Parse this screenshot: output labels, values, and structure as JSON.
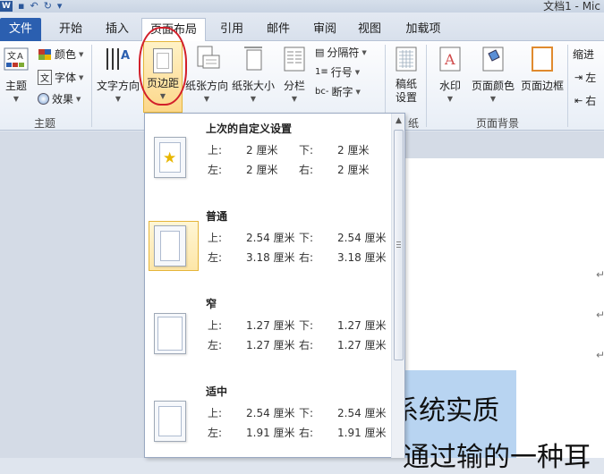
{
  "window": {
    "title": "文档1 - Mic"
  },
  "tabs": [
    {
      "label": "文件"
    },
    {
      "label": "开始"
    },
    {
      "label": "插入"
    },
    {
      "label": "页面布局",
      "active": true
    },
    {
      "label": "引用"
    },
    {
      "label": "邮件"
    },
    {
      "label": "审阅"
    },
    {
      "label": "视图"
    },
    {
      "label": "加载项"
    }
  ],
  "ribbon": {
    "themes_group": {
      "themes_label": "主题",
      "colors_label": "颜色",
      "fonts_label": "字体",
      "effects_label": "效果",
      "group_label": "主题"
    },
    "page_setup_group": {
      "text_direction_label": "文字方向",
      "margins_label": "页边距",
      "orientation_label": "纸张方向",
      "size_label": "纸张大小",
      "columns_label": "分栏",
      "breaks_label": "分隔符",
      "line_numbers_label": "行号",
      "hyphenation_label": "断字"
    },
    "manuscript_group": {
      "settings_label": "稿纸\n设置",
      "group_label_partial": "纸"
    },
    "page_background_group": {
      "watermark_label": "水印",
      "page_color_label": "页面颜色",
      "page_borders_label": "页面边框",
      "group_label": "页面背景"
    },
    "paragraph_partial": {
      "indent_label": "缩进",
      "left_label": "左",
      "right_label": "右"
    }
  },
  "margins_menu": {
    "items": [
      {
        "heading": "上次的自定义设置",
        "top_label": "上:",
        "top": "2 厘米",
        "bottom_label": "下:",
        "bottom": "2 厘米",
        "left_label": "左:",
        "left": "2 厘米",
        "right_label": "右:",
        "right": "2 厘米",
        "selected": false,
        "icon": "star-icon"
      },
      {
        "heading": "普通",
        "top_label": "上:",
        "top": "2.54 厘米",
        "bottom_label": "下:",
        "bottom": "2.54 厘米",
        "left_label": "左:",
        "left": "3.18 厘米",
        "right_label": "右:",
        "right": "3.18 厘米",
        "selected": true
      },
      {
        "heading": "窄",
        "top_label": "上:",
        "top": "1.27 厘米",
        "bottom_label": "下:",
        "bottom": "1.27 厘米",
        "left_label": "左:",
        "left": "1.27 厘米",
        "right_label": "右:",
        "right": "1.27 厘米",
        "selected": false
      },
      {
        "heading": "适中",
        "top_label": "上:",
        "top": "2.54 厘米",
        "bottom_label": "下:",
        "bottom": "2.54 厘米",
        "left_label": "左:",
        "left": "1.91 厘米",
        "right_label": "右:",
        "right": "1.91 厘米",
        "selected": false
      }
    ]
  },
  "document": {
    "line1": "系统实质",
    "line2": "通过输的一种耳",
    "paragraph_mark": "↵"
  },
  "colors": {
    "accent": "#2b5fb0",
    "annotation_red": "#d21f2a",
    "highlight": "#fcd78a",
    "selection": "#b8d4f1"
  }
}
